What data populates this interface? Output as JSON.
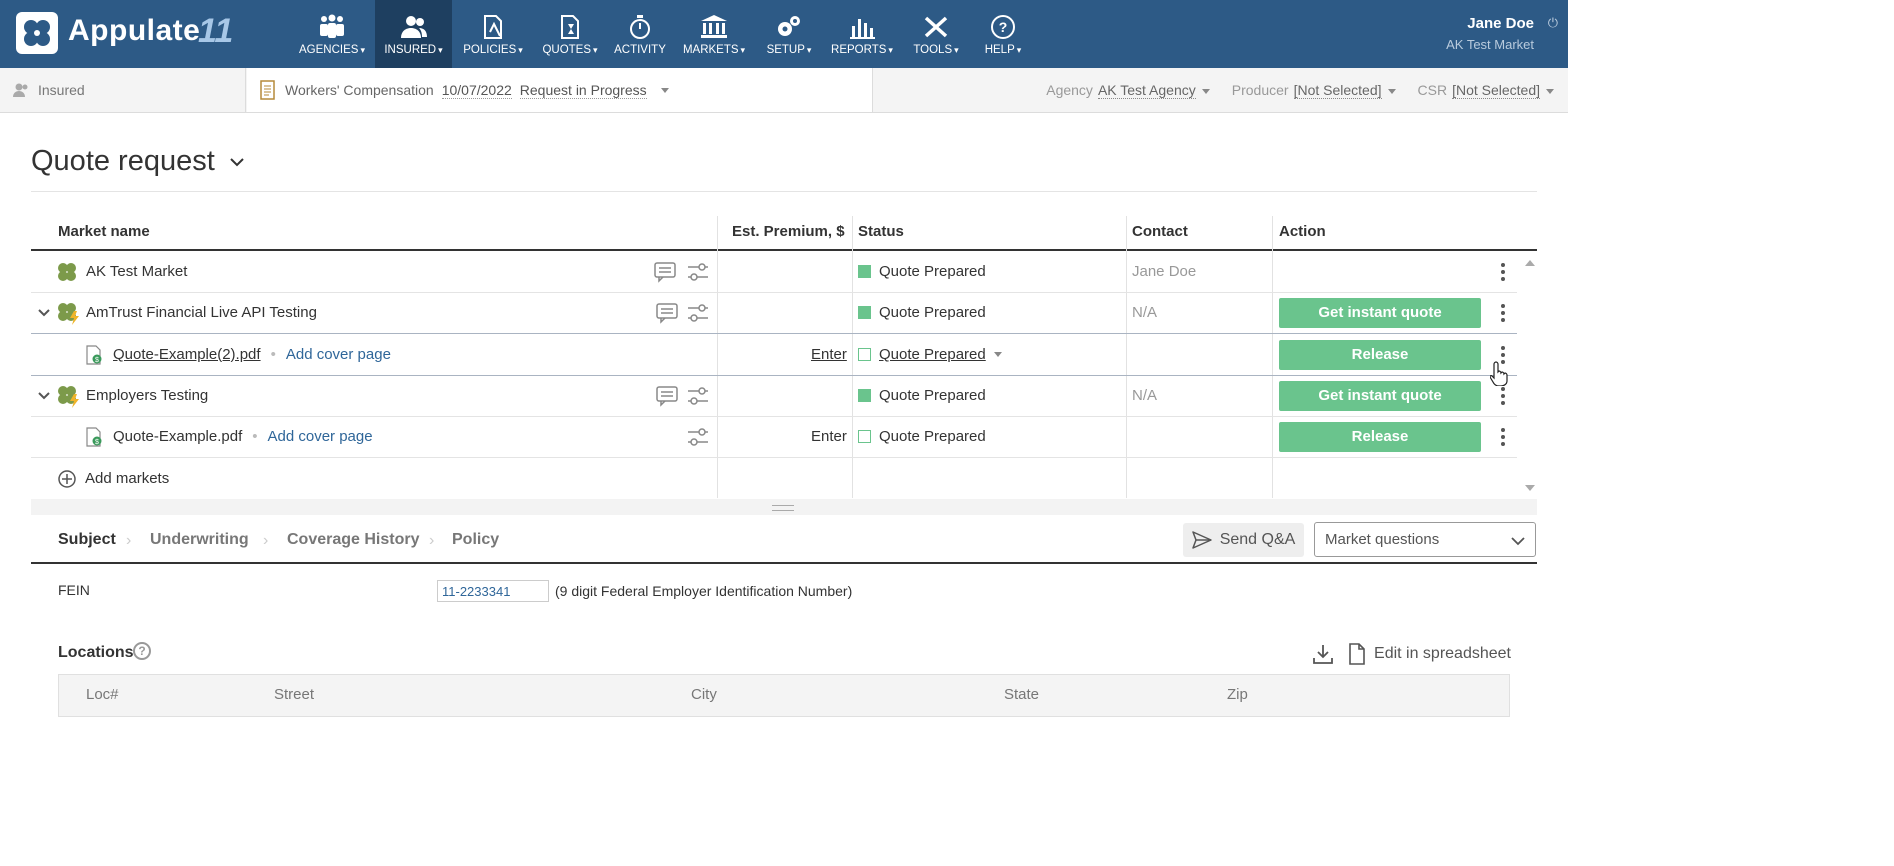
{
  "app": {
    "name": "Appulate",
    "version": "11"
  },
  "nav": [
    {
      "label": "AGENCIES",
      "icon": "agencies-icon",
      "active": false
    },
    {
      "label": "INSURED",
      "icon": "insured-icon",
      "active": true
    },
    {
      "label": "POLICIES",
      "icon": "policies-icon",
      "active": false
    },
    {
      "label": "QUOTES",
      "icon": "quotes-icon",
      "active": false
    },
    {
      "label": "ACTIVITY",
      "icon": "activity-icon",
      "active": false
    },
    {
      "label": "MARKETS",
      "icon": "markets-icon",
      "active": false
    },
    {
      "label": "SETUP",
      "icon": "setup-icon",
      "active": false
    },
    {
      "label": "REPORTS",
      "icon": "reports-icon",
      "active": false
    },
    {
      "label": "TOOLS",
      "icon": "tools-icon",
      "active": false
    },
    {
      "label": "HELP",
      "icon": "help-icon",
      "active": false
    }
  ],
  "user": {
    "name": "Jane Doe",
    "org": "AK Test Market"
  },
  "subbar": {
    "insured": "Insured",
    "policy_type": "Workers' Compensation",
    "date": "10/07/2022",
    "status": "Request in Progress",
    "agency_label": "Agency",
    "agency_value": "AK Test Agency",
    "producer_label": "Producer",
    "producer_value": "[Not Selected]",
    "csr_label": "CSR",
    "csr_value": "[Not Selected]"
  },
  "page_title": "Quote request",
  "table": {
    "headers": {
      "market": "Market name",
      "premium": "Est. Premium, $",
      "status": "Status",
      "contact": "Contact",
      "action": "Action"
    },
    "rows": [
      {
        "name": "AK Test Market",
        "status": "Quote Prepared",
        "contact": "Jane Doe"
      },
      {
        "name": "AmTrust Financial Live API Testing",
        "status": "Quote Prepared",
        "contact": "N/A",
        "action": "Get instant quote"
      },
      {
        "file": "Quote-Example(2).pdf",
        "cover": "Add cover page",
        "premium": "Enter",
        "status": "Quote Prepared",
        "action": "Release"
      },
      {
        "name": "Employers Testing",
        "status": "Quote Prepared",
        "contact": "N/A",
        "action": "Get instant quote"
      },
      {
        "file": "Quote-Example.pdf",
        "cover": "Add cover page",
        "premium": "Enter",
        "status": "Quote Prepared",
        "action": "Release"
      }
    ],
    "add_markets": "Add markets"
  },
  "tabs": [
    "Subject",
    "Underwriting",
    "Coverage History",
    "Policy"
  ],
  "send_qa": "Send Q&A",
  "market_questions": "Market questions",
  "fein": {
    "label": "FEIN",
    "value": "11-2233341",
    "hint": "(9 digit Federal Employer Identification Number)"
  },
  "locations": {
    "title": "Locations",
    "edit": "Edit in spreadsheet",
    "columns": [
      "Loc#",
      "Street",
      "City",
      "State",
      "Zip"
    ]
  }
}
